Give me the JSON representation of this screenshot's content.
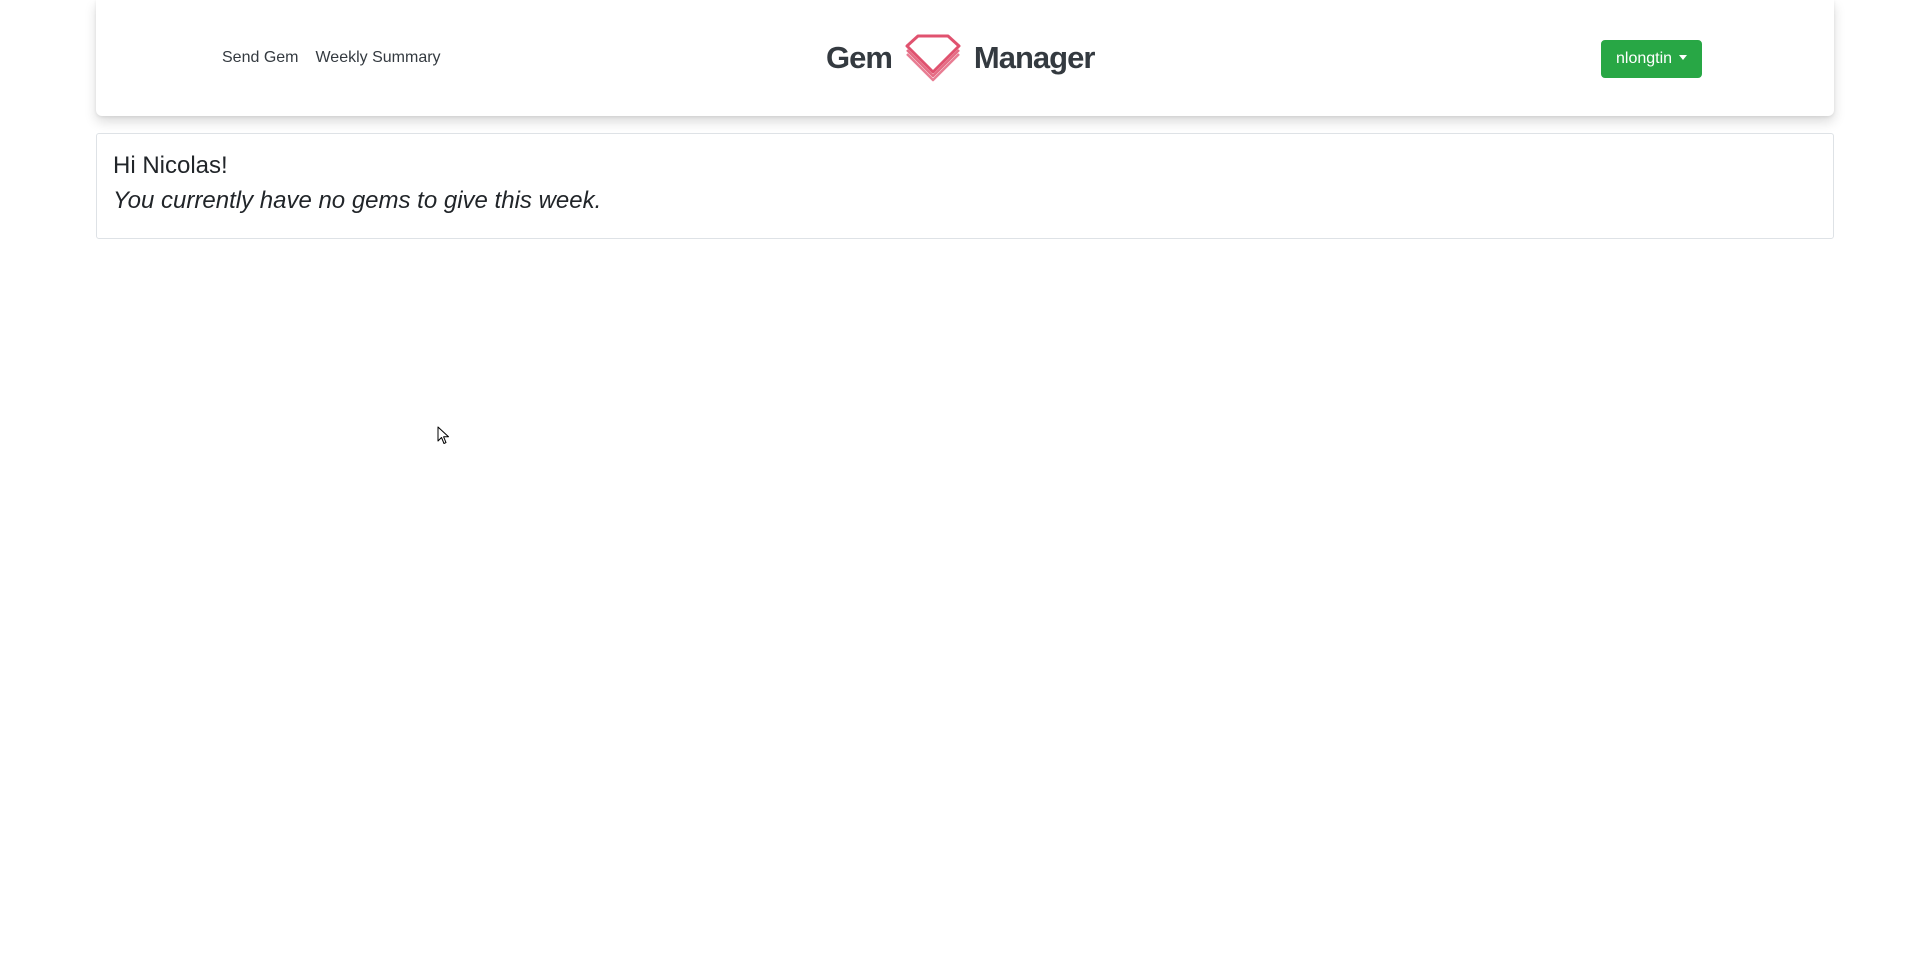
{
  "nav": {
    "links": [
      {
        "label": "Send Gem"
      },
      {
        "label": "Weekly Summary"
      }
    ]
  },
  "brand": {
    "left_text": "Gem",
    "icon": "gem-icon",
    "right_text": "Manager"
  },
  "user_menu": {
    "username": "nlongtin",
    "icon": "caret-down-icon"
  },
  "welcome_card": {
    "greeting": "Hi Nicolas!",
    "status": "You currently have no gems to give this week."
  },
  "colors": {
    "accent_green": "#28a745",
    "gem_red": "#e0526f",
    "text_dark": "#343a40"
  }
}
